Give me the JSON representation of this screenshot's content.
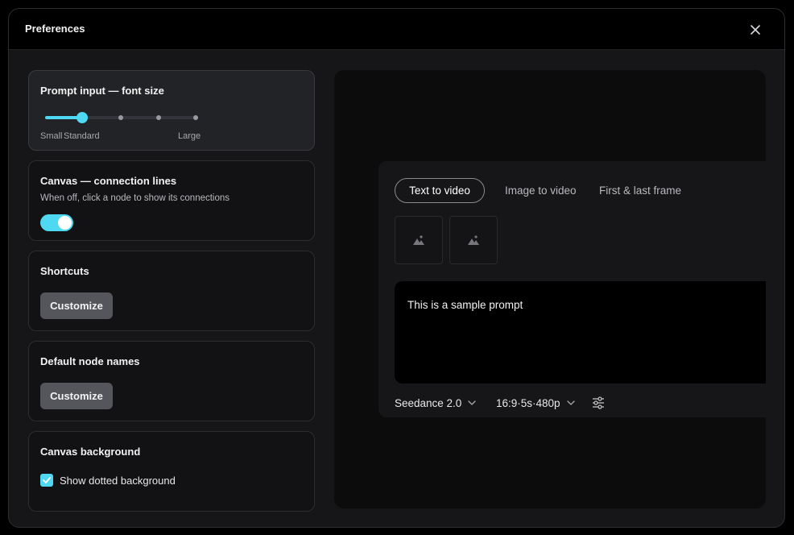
{
  "modal": {
    "title": "Preferences"
  },
  "settings": {
    "font_size": {
      "title": "Prompt input — font size",
      "labels": {
        "small": "Small",
        "standard": "Standard",
        "large": "Large"
      },
      "value_index": 1,
      "steps": 5
    },
    "connection_lines": {
      "title": "Canvas — connection lines",
      "description": "When off, click a node to show its connections",
      "enabled": true
    },
    "shortcuts": {
      "title": "Shortcuts",
      "button": "Customize"
    },
    "node_names": {
      "title": "Default node names",
      "button": "Customize"
    },
    "background": {
      "title": "Canvas background",
      "checkbox_label": "Show dotted background",
      "checked": true
    }
  },
  "preview": {
    "tabs": [
      "Text to video",
      "Image to video",
      "First & last frame"
    ],
    "active_tab": 0,
    "prompt": "This is a sample prompt",
    "model": "Seedance 2.0",
    "params": "16:9·5s·480p"
  },
  "colors": {
    "accent": "#4fd8f2",
    "button": "#55565b",
    "panel": "#161618"
  },
  "icons": {
    "close": "close-icon",
    "image": "image-icon",
    "chevron": "chevron-down-icon",
    "settings": "sliders-icon",
    "check": "check-icon"
  }
}
